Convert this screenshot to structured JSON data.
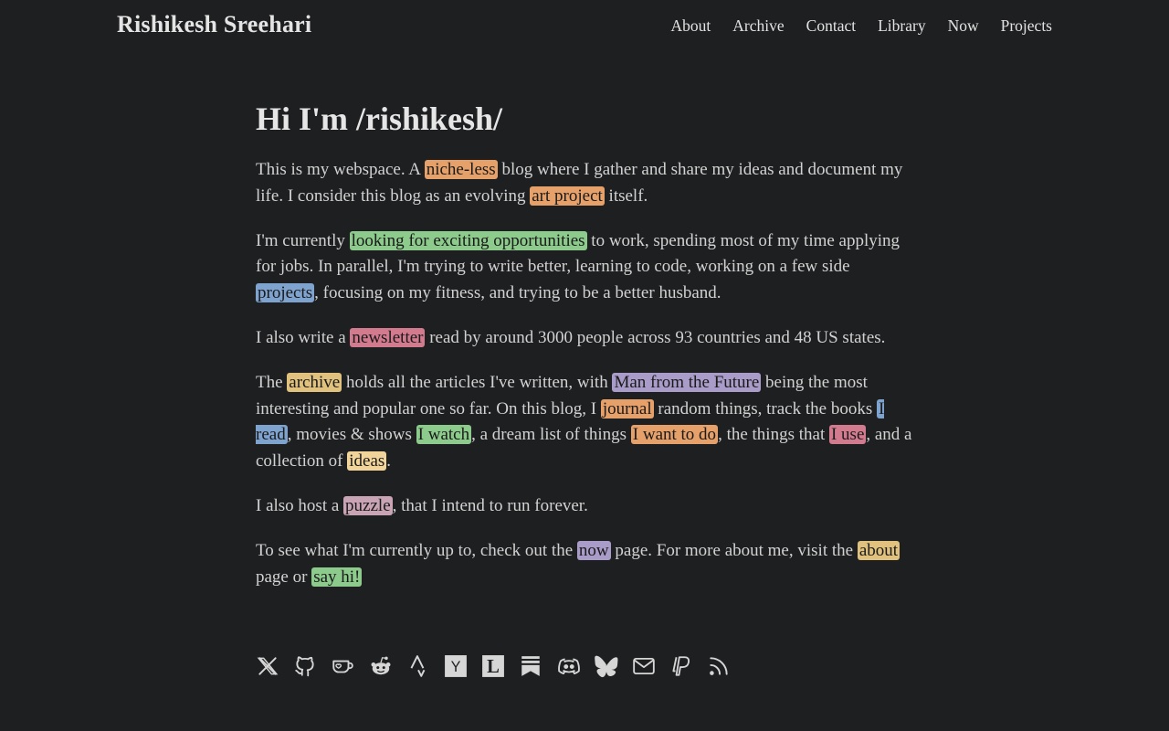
{
  "site": {
    "title": "Rishikesh Sreehari"
  },
  "nav": [
    "About",
    "Archive",
    "Contact",
    "Library",
    "Now",
    "Projects"
  ],
  "main": {
    "heading": "Hi I'm /rishikesh/",
    "p1": {
      "t1": "This is my webspace. A ",
      "l1": "niche-less",
      "t2": " blog where I gather and share my ideas and document my life. I consider this blog as an evolving ",
      "l2": "art project",
      "t3": " itself."
    },
    "p2": {
      "t1": "I'm currently ",
      "l1": "looking for exciting opportunities",
      "t2": " to work, spending most of my time applying for jobs. In parallel, I'm trying to write better, learning to code, working on a few side ",
      "l2": "projects",
      "t3": ", focusing on my fitness, and trying to be a better husband."
    },
    "p3": {
      "t1": "I also write a ",
      "l1": "newsletter",
      "t2": " read by around 3000 people across 93 countries and 48 US states."
    },
    "p4": {
      "t1": "The ",
      "l1": "archive",
      "t2": " holds all the articles I've written, with ",
      "l2": "Man from the Future",
      "t3": " being the most interesting and popular one so far. On this blog, I ",
      "l3": "journal",
      "t4": " random things, track the books ",
      "l4": "I read",
      "t5": ", movies & shows ",
      "l5": "I watch",
      "t6": ", a dream list of things ",
      "l6": "I want to do",
      "t7": ", the things that ",
      "l7": "I use",
      "t8": ", and a collection of ",
      "l8": "ideas",
      "t9": "."
    },
    "p5": {
      "t1": "I also host a ",
      "l1": "puzzle",
      "t2": ", that I intend to run forever."
    },
    "p6": {
      "t1": "To see what I'm currently up to, check out the ",
      "l1": "now",
      "t2": " page. For more about me, visit the ",
      "l2": "about",
      "t3": " page or ",
      "l3": "say hi!"
    }
  },
  "colors": {
    "background": "#1e1f21",
    "text": "#d2d2d2",
    "orange": "#e6a06a",
    "green": "#8ccb8c",
    "blue": "#7fa3cf",
    "pink": "#d27a8e",
    "tan": "#e0c27e",
    "purple": "#a99cc9",
    "yellow": "#f0d49a",
    "mauve": "#c9a4b5"
  },
  "social_icons": [
    "x-icon",
    "github-icon",
    "kofi-icon",
    "reddit-icon",
    "strava-icon",
    "hackernews-icon",
    "letterboxd-icon",
    "substack-icon",
    "discord-icon",
    "bluesky-icon",
    "email-icon",
    "paypal-icon",
    "rss-icon"
  ],
  "social_letters": {
    "hackernews": "Y",
    "letterboxd": "L"
  }
}
